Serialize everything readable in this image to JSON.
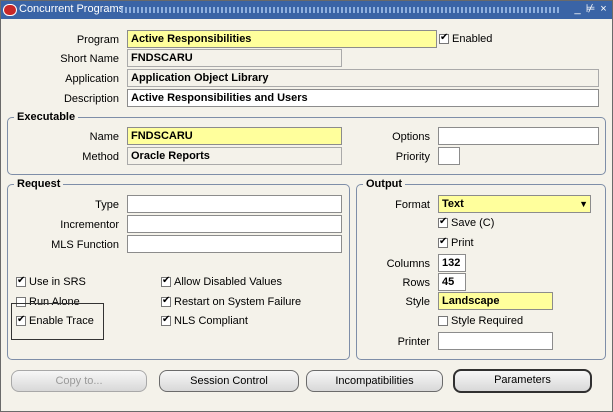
{
  "window": {
    "title": "Concurrent Programs",
    "buttons": [
      "_",
      "⊭",
      "×"
    ]
  },
  "program": {
    "program_label": "Program",
    "program_value": "Active Responsibilities",
    "enabled_label": "Enabled",
    "enabled": true,
    "short_name_label": "Short Name",
    "short_name_value": "FNDSCARU",
    "application_label": "Application",
    "application_value": "Application Object Library",
    "description_label": "Description",
    "description_value": "Active Responsibilities and Users"
  },
  "executable": {
    "title": "Executable",
    "name_label": "Name",
    "name_value": "FNDSCARU",
    "method_label": "Method",
    "method_value": "Oracle Reports",
    "options_label": "Options",
    "options_value": "",
    "priority_label": "Priority",
    "priority_value": ""
  },
  "request": {
    "title": "Request",
    "type_label": "Type",
    "incrementor_label": "Incrementor",
    "mls_label": "MLS Function",
    "use_in_srs": "Use in SRS",
    "run_alone": "Run Alone",
    "enable_trace": "Enable Trace",
    "allow_disabled": "Allow Disabled Values",
    "restart": "Restart on System Failure",
    "nls": "NLS Compliant"
  },
  "output": {
    "title": "Output",
    "format_label": "Format",
    "format_value": "Text",
    "save_label": "Save (C)",
    "print_label": "Print",
    "columns_label": "Columns",
    "columns_value": "132",
    "rows_label": "Rows",
    "rows_value": "45",
    "style_label": "Style",
    "style_value": "Landscape",
    "style_required_label": "Style Required",
    "printer_label": "Printer",
    "printer_value": ""
  },
  "buttons": {
    "copy_to": "Copy to...",
    "session_control": "Session Control",
    "incompatibilities": "Incompatibilities",
    "parameters": "Parameters"
  },
  "colors": {
    "required": "#ffff9c",
    "titlebar": "#3a64a6",
    "background": "#f4f2ea"
  }
}
